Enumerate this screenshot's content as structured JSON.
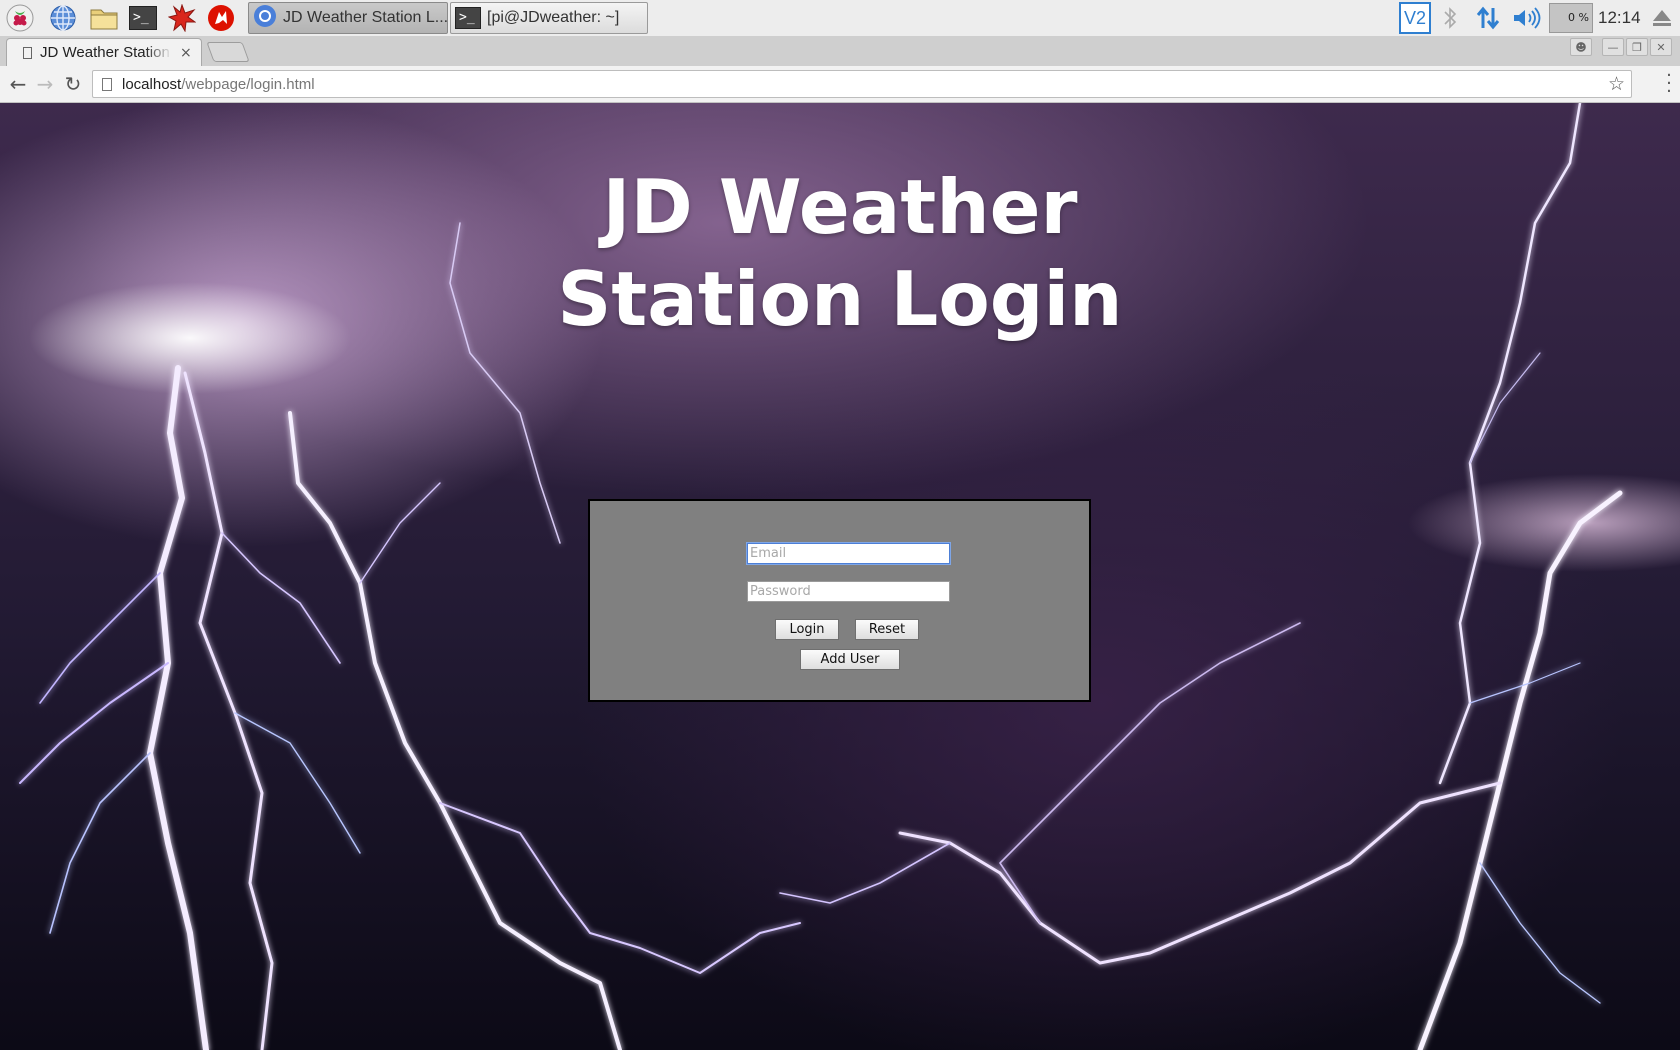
{
  "taskbar": {
    "launchers": [
      {
        "icon": "raspberry-menu-icon"
      },
      {
        "icon": "web-browser-icon"
      },
      {
        "icon": "file-manager-icon"
      },
      {
        "icon": "terminal-icon"
      },
      {
        "icon": "mathematica-icon"
      },
      {
        "icon": "wolfram-icon"
      }
    ],
    "tasks": [
      {
        "icon": "chromium-icon",
        "label": "JD Weather Station L...",
        "active": true
      },
      {
        "icon": "terminal-icon",
        "label": "[pi@JDweather: ~]",
        "active": false
      }
    ],
    "tray": {
      "vnc_label": "V2",
      "cpu_label": "0 %",
      "clock": "12:14"
    }
  },
  "browser": {
    "tab": {
      "title": "JD Weather Station Login",
      "close": "×"
    },
    "address": {
      "host": "localhost",
      "path": "/webpage/login.html"
    }
  },
  "page": {
    "title_line1": "JD Weather",
    "title_line2": "Station Login",
    "form": {
      "email_placeholder": "Email",
      "password_placeholder": "Password",
      "login_label": "Login",
      "reset_label": "Reset",
      "add_user_label": "Add User"
    }
  },
  "colors": {
    "form_background": "#808080",
    "taskbar_background": "#ededed",
    "focus_ring": "#4d7fd6"
  }
}
